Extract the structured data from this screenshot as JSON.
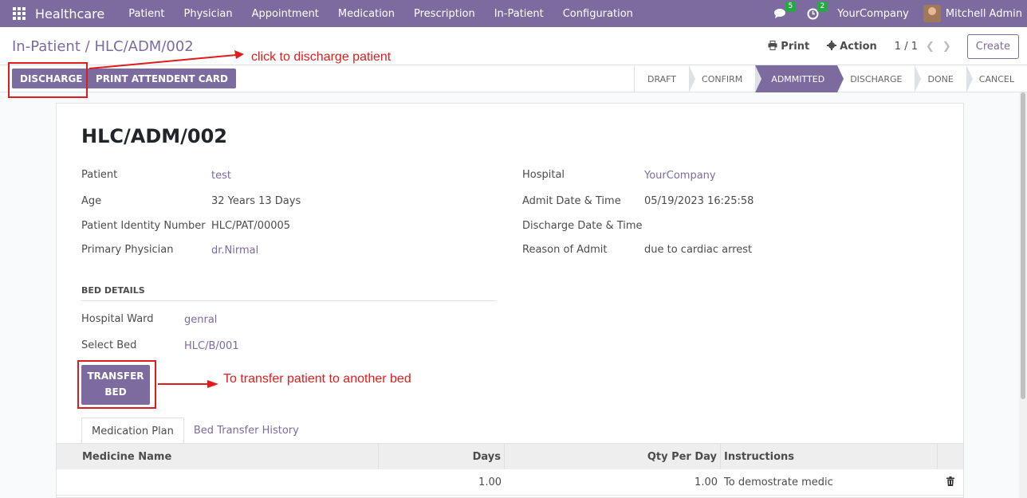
{
  "navbar": {
    "brand": "Healthcare",
    "menu": [
      "Patient",
      "Physician",
      "Appointment",
      "Medication",
      "Prescription",
      "In-Patient",
      "Configuration"
    ],
    "messages_count": "5",
    "activities_count": "2",
    "company": "YourCompany",
    "user": "Mitchell Admin"
  },
  "control_panel": {
    "breadcrumb_parent": "In-Patient",
    "breadcrumb_sep": "/",
    "breadcrumb_current": "HLC/ADM/002",
    "print_label": "Print",
    "action_label": "Action",
    "pager": "1 / 1",
    "create_label": "Create"
  },
  "statusbar": {
    "discharge_label": "DISCHARGE",
    "print_card_label": "PRINT ATTENDENT CARD",
    "stages": [
      "DRAFT",
      "CONFIRM",
      "ADMMITTED",
      "DISCHARGE",
      "DONE",
      "CANCEL"
    ],
    "active_stage": "ADMMITTED"
  },
  "record": {
    "title": "HLC/ADM/002",
    "patient_label": "Patient",
    "patient": "test",
    "age_label": "Age",
    "age": "32 Years 13 Days",
    "pin_label": "Patient Identity Number",
    "pin": "HLC/PAT/00005",
    "physician_label": "Primary Physician",
    "physician": "dr.Nirmal",
    "hospital_label": "Hospital",
    "hospital": "YourCompany",
    "admit_label": "Admit Date & Time",
    "admit": "05/19/2023 16:25:58",
    "discharge_label": "Discharge Date & Time",
    "discharge": "",
    "reason_label": "Reason of Admit",
    "reason": "due to cardiac arrest",
    "bed_section": "BED DETAILS",
    "ward_label": "Hospital Ward",
    "ward": "genral",
    "bed_label": "Select Bed",
    "bed": "HLC/B/001",
    "transfer_line1": "TRANSFER",
    "transfer_line2": "BED"
  },
  "tabs": [
    "Medication Plan",
    "Bed Transfer History"
  ],
  "table": {
    "headers": [
      "Medicine Name",
      "Days",
      "Qty Per Day",
      "Instructions"
    ],
    "rows": [
      {
        "medicine": "",
        "days": "1.00",
        "qty": "1.00",
        "instructions": "To demostrate medic"
      }
    ]
  },
  "annotations": {
    "discharge_note": "click to discharge patient",
    "transfer_note": "To transfer patient to another bed"
  },
  "colors": {
    "brand": "#7c6b9f",
    "annotation": "#e01b1b"
  }
}
